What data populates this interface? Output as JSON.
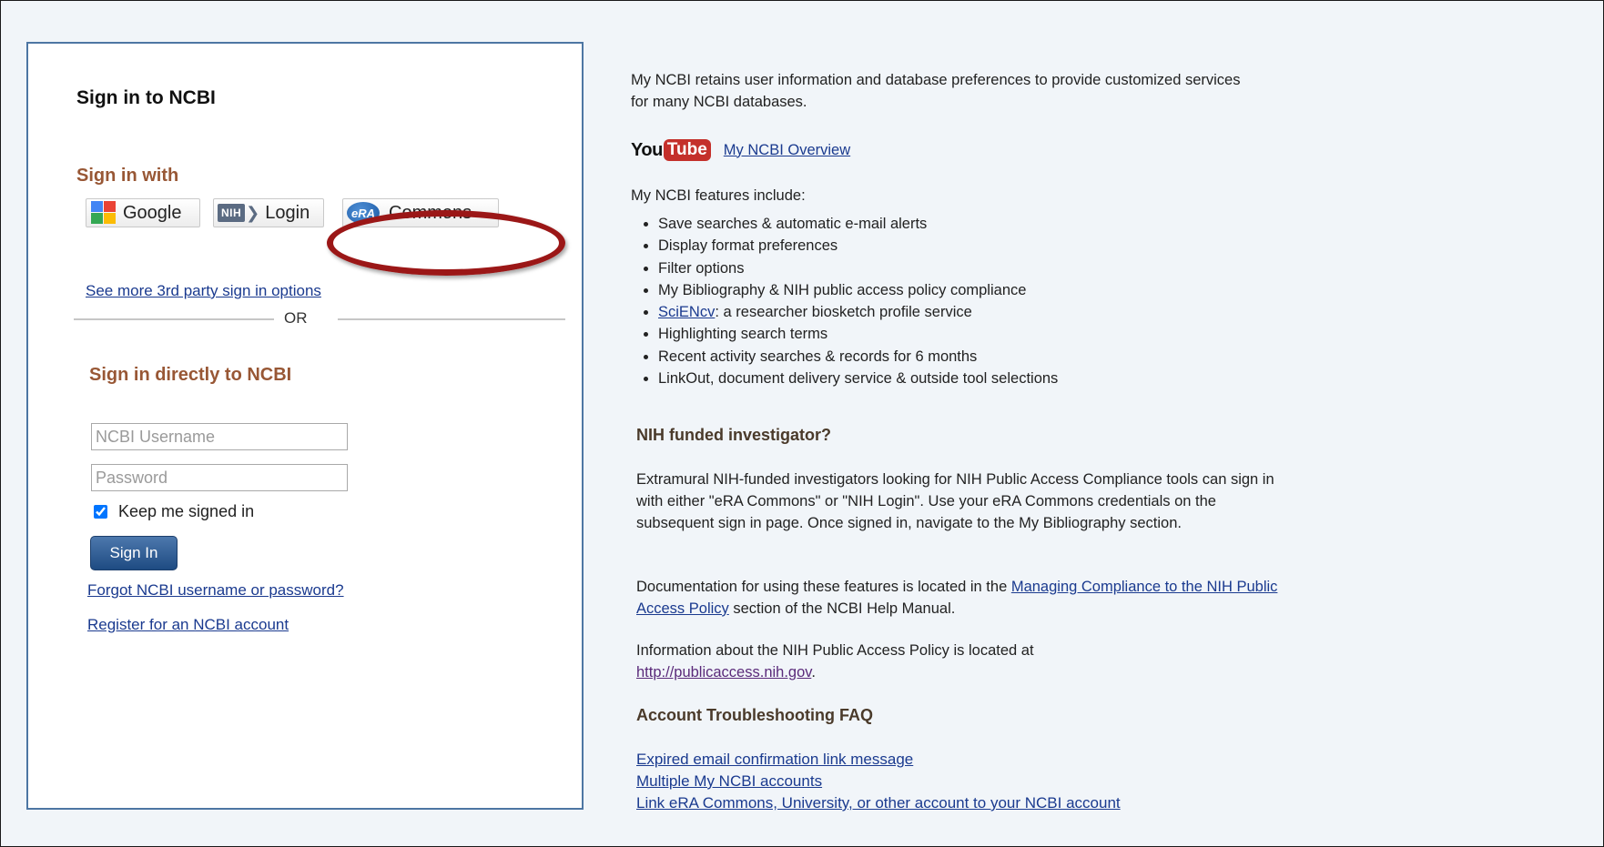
{
  "signin_panel": {
    "title": "Sign in to NCBI",
    "signin_with_heading": "Sign in with",
    "providers": {
      "google": "Google",
      "nih_badge": "NIH",
      "nih": "Login",
      "era_badge": "eRA",
      "era": "Commons"
    },
    "more_options_link": "See more 3rd party sign in options",
    "or_label": "OR",
    "direct_heading": "Sign in directly to NCBI",
    "username_placeholder": "NCBI Username",
    "password_placeholder": "Password",
    "keep_signed_in_label": "Keep me signed in",
    "keep_signed_in_checked": true,
    "signin_button": "Sign In",
    "forgot_link": "Forgot NCBI username or password?",
    "register_link": "Register for an NCBI account"
  },
  "info": {
    "intro": "My NCBI retains user information and database preferences to provide customized services for many NCBI databases.",
    "youtube": {
      "you": "You",
      "tube": "Tube",
      "link": "My NCBI Overview"
    },
    "features_heading": "My NCBI features include:",
    "features": [
      {
        "text": "Save searches & automatic e-mail alerts"
      },
      {
        "text": "Display format preferences"
      },
      {
        "text": "Filter options"
      },
      {
        "text": "My Bibliography & NIH public access policy compliance"
      },
      {
        "link": "SciENcv",
        "text": ": a researcher biosketch profile service"
      },
      {
        "text": "Highlighting search terms"
      },
      {
        "text": "Recent activity searches & records for 6 months"
      },
      {
        "text": "LinkOut, document delivery service & outside tool selections"
      }
    ],
    "nih_heading": "NIH funded investigator?",
    "nih_paragraph": "Extramural NIH-funded investigators looking for NIH Public Access Compliance tools can sign in with either \"eRA Commons\" or \"NIH Login\". Use your eRA Commons credentials on the subsequent sign in page. Once signed in, navigate to the My Bibliography section.",
    "doc_paragraph": {
      "before": "Documentation for using these features is located in the ",
      "link": "Managing Compliance to the NIH Public Access Policy",
      "after": " section of the NCBI Help Manual."
    },
    "policy_paragraph": {
      "before": "Information about the NIH Public Access Policy is located at ",
      "link": "http://publicaccess.nih.gov",
      "after": "."
    },
    "faq_heading": "Account Troubleshooting FAQ",
    "faq_links": [
      "Expired email confirmation link message",
      "Multiple My NCBI accounts",
      "Link eRA Commons, University, or other account to your NCBI account"
    ]
  },
  "colors": {
    "panel_border": "#4d76a3",
    "heading_brown": "#985735",
    "link_blue": "#1a3a8f",
    "highlight_ellipse": "#9b1717",
    "signin_button": "#1e4b82"
  }
}
